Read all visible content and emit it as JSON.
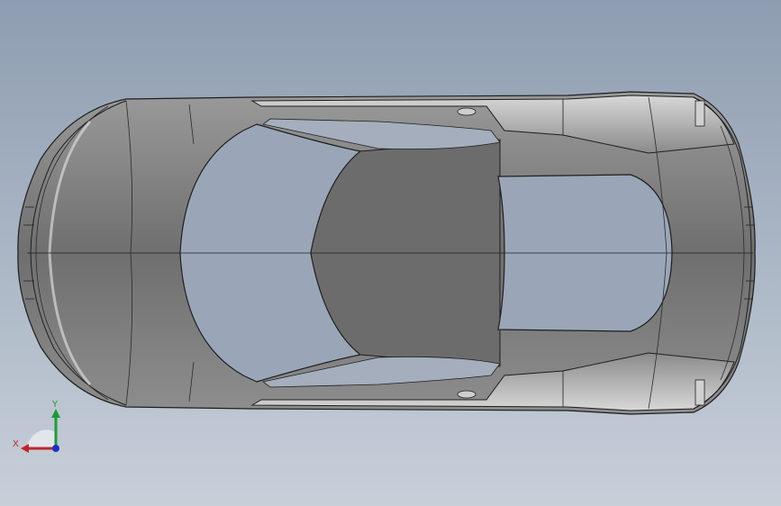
{
  "viewport": {
    "background_top": "#8e9db1",
    "background_bottom": "#c7cfd9"
  },
  "model": {
    "type": "car-body-top-view",
    "body_color": "#7a7a7a",
    "glass_color": "#9aa6b8",
    "edge_color": "#1e1e1e"
  },
  "triad": {
    "x_label": "X",
    "y_label": "Y",
    "x_color": "#c0262b",
    "y_color": "#1f9a3a",
    "z_color": "#1f2ec7"
  }
}
